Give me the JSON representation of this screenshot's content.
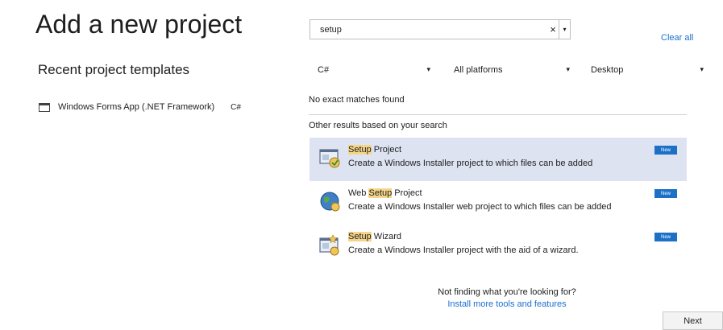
{
  "page": {
    "title": "Add a new project"
  },
  "recent": {
    "heading": "Recent project templates",
    "items": [
      {
        "name": "Windows Forms App (.NET Framework)",
        "lang": "C#",
        "icon": "window-form-icon"
      }
    ]
  },
  "search": {
    "value": "setup",
    "clear_glyph": "×",
    "dropdown_glyph": "▾"
  },
  "clear_all": "Clear all",
  "filters": {
    "language": "C#",
    "platform": "All platforms",
    "project_type": "Desktop",
    "caret": "▾"
  },
  "results": {
    "no_match": "No exact matches found",
    "other_heading": "Other results based on your search",
    "items": [
      {
        "pre": "",
        "hl": "Setup",
        "post": " Project",
        "desc": "Create a Windows Installer project to which files can be added",
        "badge": "New",
        "icon": "setup-project-icon"
      },
      {
        "pre": "Web ",
        "hl": "Setup",
        "post": " Project",
        "desc": "Create a Windows Installer web project to which files can be added",
        "badge": "New",
        "icon": "web-setup-globe-icon"
      },
      {
        "pre": "",
        "hl": "Setup",
        "post": " Wizard",
        "desc": "Create a Windows Installer project with the aid of a wizard.",
        "badge": "New",
        "icon": "setup-wizard-icon"
      }
    ]
  },
  "footer": {
    "question": "Not finding what you're looking for?",
    "link": "Install more tools and features"
  },
  "next_label": "Next",
  "colors": {
    "accent": "#1c71c7",
    "link": "#1a6fcf",
    "selected_bg": "#dde3f1",
    "highlight": "#f5d58a"
  }
}
